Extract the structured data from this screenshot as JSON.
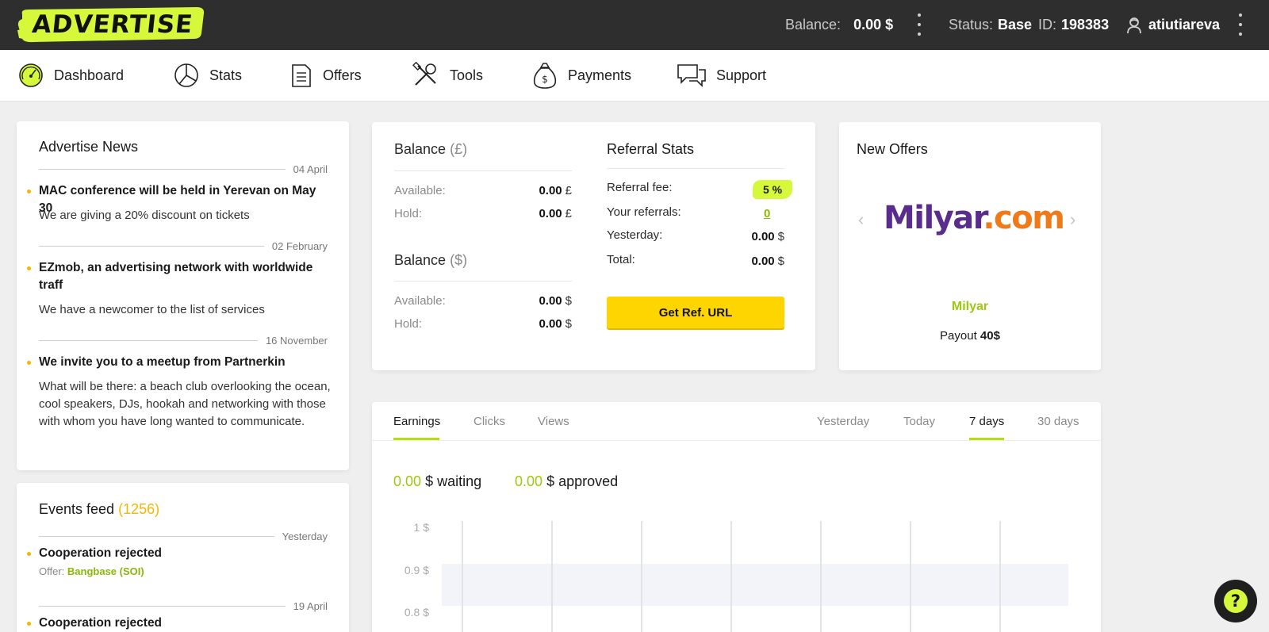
{
  "header": {
    "logo": "ADVERTISE",
    "balance_label": "Balance:",
    "balance_value": "0.00 $",
    "status_label": "Status:",
    "status_value": "Base",
    "id_label": "ID:",
    "id_value": "198383",
    "username": "atiutiareva"
  },
  "nav": [
    {
      "label": "Dashboard",
      "icon": "dashboard-gauge-icon"
    },
    {
      "label": "Stats",
      "icon": "pie-chart-icon"
    },
    {
      "label": "Offers",
      "icon": "document-icon"
    },
    {
      "label": "Tools",
      "icon": "wrench-screwdriver-icon"
    },
    {
      "label": "Payments",
      "icon": "money-bag-icon"
    },
    {
      "label": "Support",
      "icon": "chat-bubbles-icon"
    }
  ],
  "news": {
    "title": "Advertise News",
    "items": [
      {
        "date": "04 April",
        "headline": "MAC conference will be held in Yerevan on May 30",
        "body": "We are giving a 20% discount on tickets"
      },
      {
        "date": "02 February",
        "headline": "EZmob, an advertising network with worldwide traff",
        "body": "We have a newcomer to the list of services"
      },
      {
        "date": "16 November",
        "headline": "We invite you to a meetup from Partnerkin",
        "body": "What will be there: a beach club overlooking the ocean, cool speakers, DJs, hookah and networking with those with whom you have long wanted to communicate."
      }
    ]
  },
  "events": {
    "title": "Events feed",
    "count": "(1256)",
    "items": [
      {
        "date": "Yesterday",
        "headline": "Cooperation rejected",
        "offer_label": "Offer:",
        "offer": "Bangbase (SOI)"
      },
      {
        "date": "19 April",
        "headline": "Cooperation rejected"
      }
    ]
  },
  "balance": {
    "gbp_title": "Balance",
    "gbp_unit": "(£)",
    "usd_title": "Balance",
    "usd_unit": "($)",
    "available_label": "Available:",
    "hold_label": "Hold:",
    "gbp_available": "0.00",
    "gbp_hold": "0.00",
    "gbp_sign": "£",
    "usd_available": "0.00",
    "usd_hold": "0.00",
    "usd_sign": "$"
  },
  "referral": {
    "title": "Referral Stats",
    "fee_label": "Referral fee:",
    "fee_value": "5 %",
    "referrals_label": "Your referrals:",
    "referrals_value": "0",
    "yesterday_label": "Yesterday:",
    "yesterday_value": "0.00",
    "total_label": "Total:",
    "total_value": "0.00",
    "currency": "$",
    "button": "Get Ref. URL"
  },
  "offers": {
    "title": "New Offers",
    "logo_part1": "Milyar",
    "logo_part2": ".com",
    "name": "Milyar",
    "payout_label": "Payout",
    "payout_value": "40$"
  },
  "stats": {
    "tabs": [
      "Earnings",
      "Clicks",
      "Views"
    ],
    "active_tab": "Earnings",
    "periods": [
      "Yesterday",
      "Today",
      "7 days",
      "30 days"
    ],
    "active_period": "7 days",
    "waiting_value": "0.00",
    "waiting_label": "$ waiting",
    "approved_value": "0.00",
    "approved_label": "$ approved"
  },
  "chart_data": {
    "type": "bar",
    "yticks": [
      "1 $",
      "0.9 $",
      "0.8 $"
    ],
    "ytick_values": [
      1,
      0.9,
      0.8
    ],
    "categories_count": 7,
    "values": [
      0,
      0,
      0,
      0,
      0,
      0,
      0
    ]
  },
  "colors": {
    "accent_green": "#9ec70f",
    "accent_yellow": "#ffd500",
    "dark": "#2e2e2e"
  }
}
